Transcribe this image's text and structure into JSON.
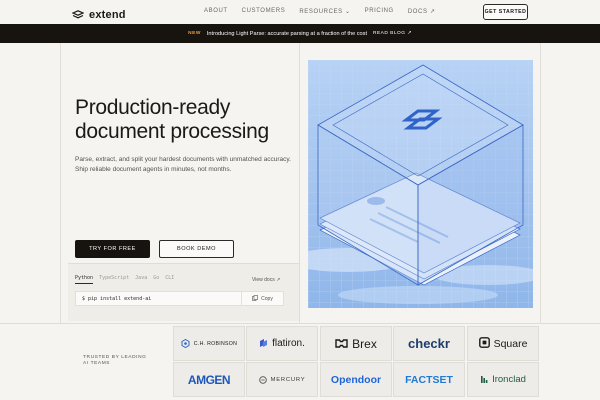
{
  "nav": {
    "brand": "extend",
    "links": [
      "ABOUT",
      "CUSTOMERS",
      "RESOURCES ⌄",
      "PRICING",
      "DOCS ↗"
    ],
    "cta": "GET STARTED"
  },
  "announcement": {
    "badge": "NEW",
    "text": "Introducing Light Parse: accurate parsing at a fraction of the cost",
    "link": "READ BLOG ↗"
  },
  "hero": {
    "title": "Production-ready document processing",
    "subtitle": "Parse, extract, and split your hardest documents with unmatched accuracy. Ship reliable document agents in minutes, not months.",
    "primary_cta": "TRY FOR FREE",
    "secondary_cta": "BOOK DEMO"
  },
  "code": {
    "tabs": [
      "Python",
      "TypeScript",
      "Java",
      "Go",
      "CLI"
    ],
    "active_tab": "Python",
    "view_docs": "View docs ↗",
    "command": "$ pip install extend-ai",
    "copy_label": "Copy"
  },
  "trusted": {
    "label": "TRUSTED BY LEADING AI TEAMS",
    "logos": [
      "C.H. ROBINSON",
      "flatiron.",
      "Brex",
      "checkr",
      "Square",
      "AMGEN",
      "MERCURY",
      "Opendoor",
      "FACTSET",
      "Ironclad"
    ]
  },
  "colors": {
    "accent_blue": "#2f63c8",
    "illustration_bg": "#a9c8f2",
    "announce_bg": "#17130f",
    "new_badge": "#f29a3d"
  }
}
